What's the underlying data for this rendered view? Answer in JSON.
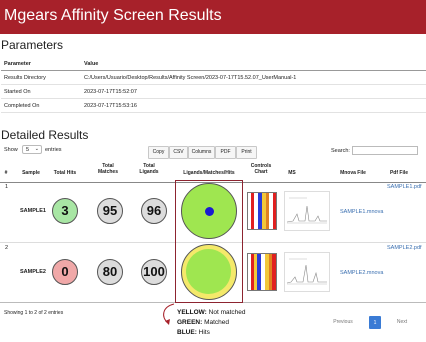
{
  "app": {
    "title": "Mgears Affinity Screen Results"
  },
  "parameters": {
    "heading": "Parameters",
    "col_param": "Parameter",
    "col_value": "Value",
    "rows": [
      {
        "name": "Results Directory",
        "value": "C:/Users/Usuario/Desktop/Results/Affinity Screen/2023-07-17T15.52.07_UserManual-1"
      },
      {
        "name": "Started On",
        "value": "2023-07-17T15:52:07"
      },
      {
        "name": "Completed On",
        "value": "2023-07-17T15:53:16"
      }
    ]
  },
  "detailed": {
    "heading": "Detailed Results",
    "show_label": "Show",
    "show_value": "5",
    "entries_label": "entries",
    "buttons": {
      "copy": "Copy",
      "csv": "CSV",
      "columns": "Columns",
      "pdf": "PDF",
      "print": "Print"
    },
    "search_label": "Search:",
    "search_value": "",
    "columns": {
      "index": "#",
      "sample": "Sample",
      "total_hits": "Total Hits",
      "total_matches": "Total Matches",
      "total_ligands": "Total Ligands",
      "ligands": "Ligands/Matches/Hits",
      "controls": "Controls Chart",
      "ms": "MS",
      "mnova": "Mnova File",
      "pdf": "Pdf File"
    },
    "rows": [
      {
        "index": "1",
        "sample": "SAMPLE1",
        "total_hits": "3",
        "total_matches": "95",
        "total_ligands": "96",
        "hits_color": "#a8e6a4",
        "mnova": "SAMPLE1.mnova",
        "pdf": "SAMPLE1.pdf"
      },
      {
        "index": "2",
        "sample": "SAMPLE2",
        "total_hits": "0",
        "total_matches": "80",
        "total_ligands": "100",
        "hits_color": "#f0a8a8",
        "mnova": "SAMPLE2.mnova",
        "pdf": "SAMPLE2.pdf"
      }
    ],
    "footer": "Showing 1 to 2 of 2 entries",
    "pagination": {
      "previous": "Previous",
      "current": "1",
      "next": "Next"
    }
  },
  "legend": {
    "yellow_key": "YELLOW:",
    "yellow_text": "Not matched",
    "green_key": "GREEN:",
    "green_text": "Matched",
    "blue_key": "BLUE:",
    "blue_text": "Hits"
  },
  "colors": {
    "header": "#a7212a",
    "yellow": "#f4e96a",
    "green": "#9fe650",
    "blue": "#1a1ad0",
    "link": "#3a6fb0"
  }
}
